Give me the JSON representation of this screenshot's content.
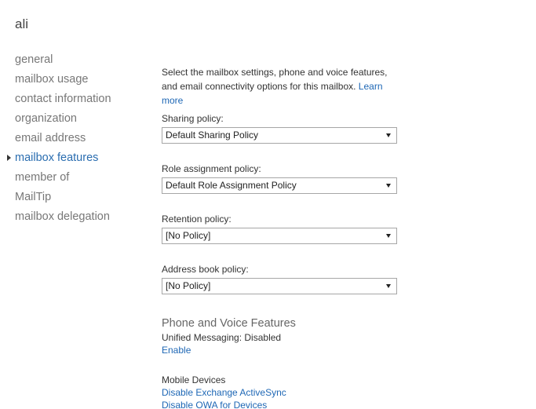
{
  "header": {
    "title": "ali"
  },
  "nav": {
    "items": [
      {
        "label": "general"
      },
      {
        "label": "mailbox usage"
      },
      {
        "label": "contact information"
      },
      {
        "label": "organization"
      },
      {
        "label": "email address"
      },
      {
        "label": "mailbox features"
      },
      {
        "label": "member of"
      },
      {
        "label": "MailTip"
      },
      {
        "label": "mailbox delegation"
      }
    ],
    "active": "mailbox features"
  },
  "main": {
    "intro_text": "Select the mailbox settings, phone and voice features, and email connectivity options for this mailbox.",
    "learn_more_label": "Learn more",
    "policies": [
      {
        "label": "Sharing policy:",
        "value": "Default Sharing Policy"
      },
      {
        "label": "Role assignment policy:",
        "value": "Default Role Assignment Policy"
      },
      {
        "label": "Retention policy:",
        "value": "[No Policy]"
      },
      {
        "label": "Address book policy:",
        "value": "[No Policy]"
      }
    ],
    "phone_voice": {
      "heading": "Phone and Voice Features",
      "status": "Unified Messaging: Disabled",
      "action": "Enable"
    },
    "mobile": {
      "heading": "Mobile Devices",
      "disable_activesync": "Disable Exchange ActiveSync",
      "disable_owa": "Disable OWA for Devices"
    }
  },
  "colors": {
    "link": "#1e67b5",
    "active_nav": "#2a6db0",
    "muted_nav": "#777777"
  }
}
